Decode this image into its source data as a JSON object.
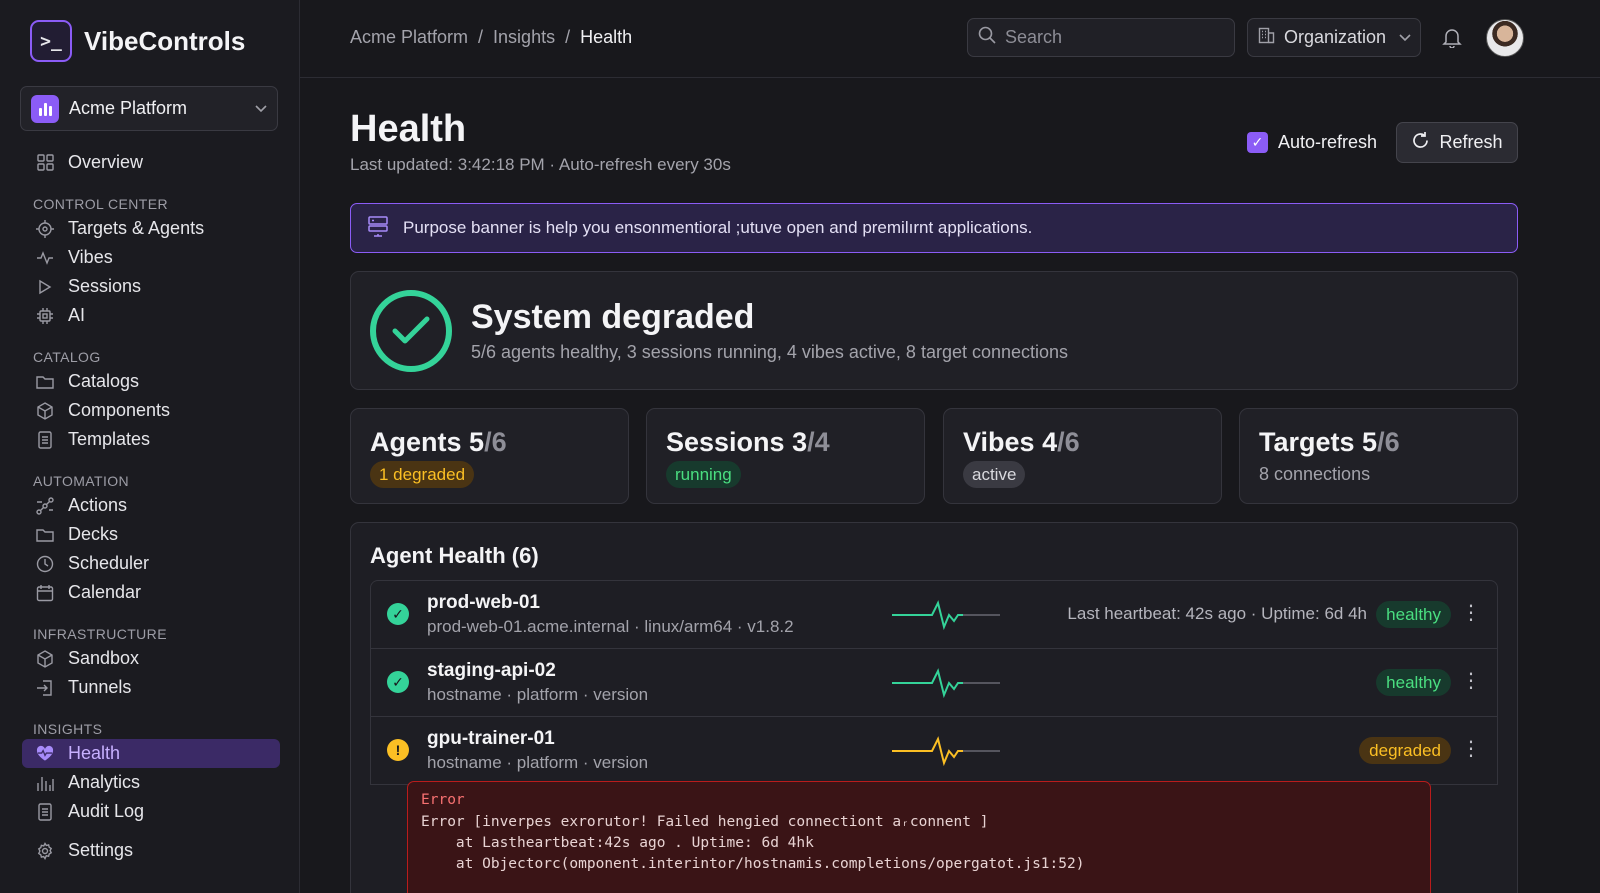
{
  "app": {
    "name": "VibeControls",
    "logo_glyph": ">_"
  },
  "workspace": {
    "label": "Acme Platform"
  },
  "sidebar": {
    "top": [
      {
        "label": "Overview",
        "icon": "grid-icon"
      }
    ],
    "sections": [
      {
        "title": "CONTROL CENTER",
        "items": [
          {
            "label": "Targets & Agents",
            "icon": "target-icon"
          },
          {
            "label": "Vibes",
            "icon": "pulse-icon"
          },
          {
            "label": "Sessions",
            "icon": "play-icon"
          },
          {
            "label": "AI",
            "icon": "chip-icon"
          }
        ]
      },
      {
        "title": "CATALOG",
        "items": [
          {
            "label": "Catalogs",
            "icon": "folder-icon"
          },
          {
            "label": "Components",
            "icon": "cube-icon"
          },
          {
            "label": "Templates",
            "icon": "document-icon"
          }
        ]
      },
      {
        "title": "AUTOMATION",
        "items": [
          {
            "label": "Actions",
            "icon": "workflow-icon"
          },
          {
            "label": "Decks",
            "icon": "folder-icon"
          },
          {
            "label": "Scheduler",
            "icon": "clock-icon"
          },
          {
            "label": "Calendar",
            "icon": "calendar-icon"
          }
        ]
      },
      {
        "title": "INFRASTRUCTURE",
        "items": [
          {
            "label": "Sandbox",
            "icon": "cube-icon"
          },
          {
            "label": "Tunnels",
            "icon": "tunnel-icon"
          }
        ]
      },
      {
        "title": "INSIGHTS",
        "items": [
          {
            "label": "Health",
            "icon": "heart-pulse-icon",
            "active": true
          },
          {
            "label": "Analytics",
            "icon": "bar-chart-icon"
          },
          {
            "label": "Audit Log",
            "icon": "document-icon"
          }
        ]
      }
    ],
    "settings": {
      "label": "Settings",
      "icon": "gear-icon"
    }
  },
  "topbar": {
    "breadcrumb": [
      "Acme Platform",
      "Insights",
      "Health"
    ],
    "breadcrumb_sep": "/",
    "search_placeholder": "Search",
    "org_label": "Organization"
  },
  "page": {
    "title": "Health",
    "subtitle": "Last updated: 3:42:18 PM · Auto-refresh every 30s",
    "auto_refresh_label": "Auto-refresh",
    "auto_refresh_checked": true,
    "refresh_label": "Refresh"
  },
  "banner": {
    "text": "Purpose banner is help you ensonmentioral ;utuve open and premilırnt applications."
  },
  "status": {
    "title": "System degraded",
    "summary": "5/6 agents healthy, 3 sessions running, 4 vibes active, 8 target connections"
  },
  "stats": [
    {
      "label": "Agents",
      "value": "5",
      "total": "/6",
      "pill": "1 degraded",
      "pill_kind": "amber"
    },
    {
      "label": "Sessions",
      "value": "3",
      "total": "/4",
      "pill": "running",
      "pill_kind": "green"
    },
    {
      "label": "Vibes",
      "value": "4",
      "total": "/6",
      "pill": "active",
      "pill_kind": "gray"
    },
    {
      "label": "Targets",
      "value": "5",
      "total": "/6",
      "text": "8 connections"
    }
  ],
  "agent_health": {
    "title": "Agent Health (6)",
    "rows": [
      {
        "name": "prod-web-01",
        "meta": "prod-web-01.acme.internal · linux/arm64 · v1.8.2",
        "heartbeat": "Last heartbeat: 42s ago · Uptime: 6d 4h",
        "status": "healthy",
        "state": "ok",
        "spark_color": "#34d399"
      },
      {
        "name": "staging-api-02",
        "meta": "hostname · platform · version",
        "heartbeat": "",
        "status": "healthy",
        "state": "ok",
        "spark_color": "#34d399"
      },
      {
        "name": "gpu-trainer-01",
        "meta": "hostname · platform · version",
        "heartbeat": "",
        "status": "degraded",
        "state": "warn",
        "spark_color": "#fbbf24"
      }
    ],
    "error": {
      "heading": "Error",
      "lines": [
        "Error [inverpes exrorutor! Failed hengied connectiont aᵣconnent ]",
        "    at Lastheartbeat:42s ago . Uptime: 6d 4hk",
        "    at Objectorc(omponent.interintor/hostnamis.completions/opergatot.js1:52)"
      ]
    }
  },
  "colors": {
    "accent": "#8b5cf6",
    "healthy": "#34d399",
    "degraded": "#fbbf24",
    "error": "#b91c1c"
  }
}
